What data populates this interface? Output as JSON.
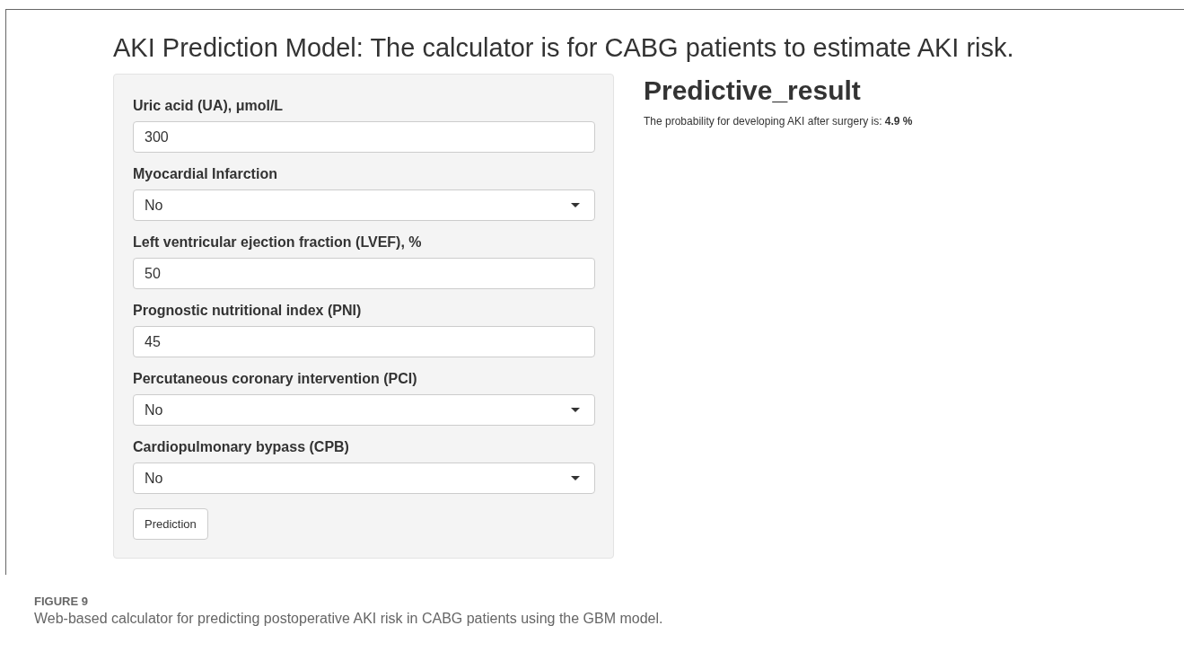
{
  "title": "AKI Prediction Model: The calculator is for CABG patients to estimate AKI risk.",
  "fields": [
    {
      "kind": "text",
      "label": "Uric acid (UA), μmol/L",
      "value": "300"
    },
    {
      "kind": "select",
      "label": "Myocardial Infarction",
      "value": "No"
    },
    {
      "kind": "text",
      "label": "Left ventricular ejection fraction (LVEF), %",
      "value": "50"
    },
    {
      "kind": "text",
      "label": "Prognostic nutritional index (PNI)",
      "value": "45"
    },
    {
      "kind": "select",
      "label": "Percutaneous coronary intervention (PCI)",
      "value": "No"
    },
    {
      "kind": "select",
      "label": "Cardiopulmonary bypass (CPB)",
      "value": "No"
    }
  ],
  "button": "Prediction",
  "result": {
    "heading": "Predictive_result",
    "text": "The probability for developing AKI after surgery is: **4.9 %**"
  },
  "caption": {
    "label": "FIGURE 9",
    "text": "Web-based calculator for predicting postoperative AKI risk in CABG patients using the GBM model."
  }
}
